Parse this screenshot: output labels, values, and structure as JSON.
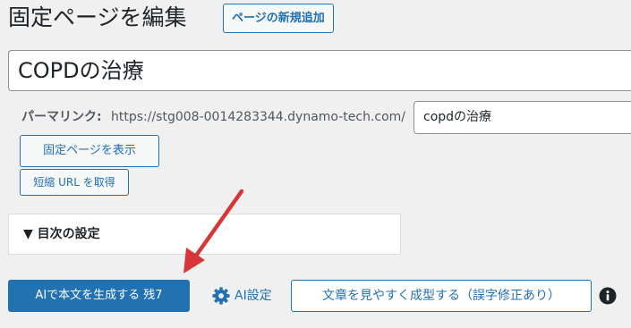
{
  "header": {
    "title": "固定ページを編集",
    "add_new_label": "ページの新規追加"
  },
  "post_title": {
    "value": "COPDの治療"
  },
  "permalink": {
    "label": "パーマリンク:",
    "base_url": "https://stg008-0014283344.dynamo-tech.com/",
    "slug_value": "copdの治療"
  },
  "buttons": {
    "view_page": "固定ページを表示",
    "get_shortlink": "短縮 URL を取得"
  },
  "toc": {
    "label": "▼ 目次の設定"
  },
  "ai": {
    "generate_label": "AIで本文を生成する 残7",
    "settings_label": "AI設定",
    "format_label": "文章を見やすく成型する（誤字修正あり）"
  },
  "colors": {
    "primary": "#2271b1",
    "background": "#f0f0f1",
    "annotation_arrow": "#d63638"
  },
  "icons": {
    "settings": "gear-icon",
    "info": "info-icon",
    "annotation": "arrow-icon"
  }
}
